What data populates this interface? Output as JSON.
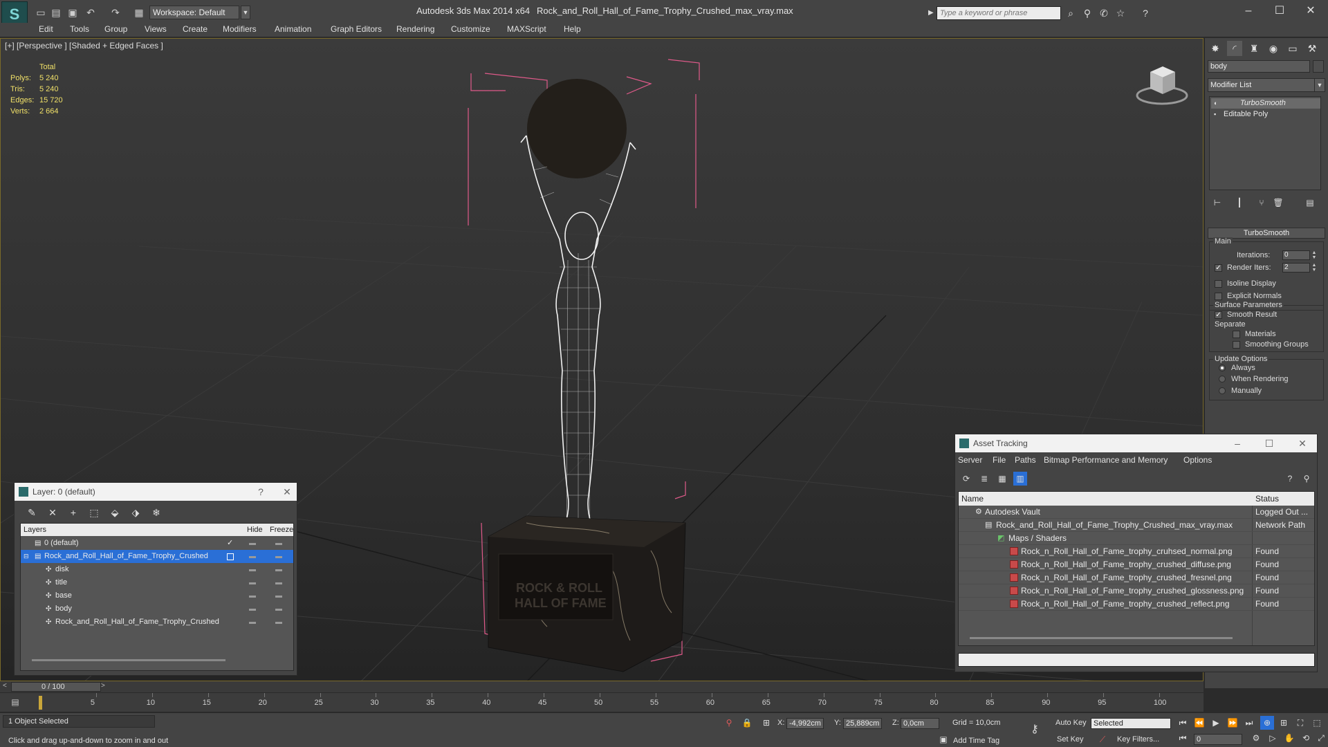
{
  "titlebar": {
    "workspace": "Workspace: Default",
    "app_title": "Autodesk 3ds Max  2014 x64",
    "file_title": "Rock_and_Roll_Hall_of_Fame_Trophy_Crushed_max_vray.max",
    "search_placeholder": "Type a keyword or phrase"
  },
  "menu": [
    "Edit",
    "Tools",
    "Group",
    "Views",
    "Create",
    "Modifiers",
    "Animation",
    "Graph Editors",
    "Rendering",
    "Customize",
    "MAXScript",
    "Help"
  ],
  "viewport": {
    "label": "[+] [Perspective ] [Shaded + Edged Faces ]",
    "stats_header": "Total",
    "stats": [
      {
        "key": "Polys:",
        "value": "5 240"
      },
      {
        "key": "Tris:",
        "value": "5 240"
      },
      {
        "key": "Edges:",
        "value": "15 720"
      },
      {
        "key": "Verts:",
        "value": "2 664"
      }
    ],
    "plaque_line1": "ROCK & ROLL",
    "plaque_line2": "HALL OF FAME"
  },
  "command_panel": {
    "object_name": "body",
    "modifier_list": "Modifier List",
    "stack": [
      "TurboSmooth",
      "Editable Poly"
    ],
    "rollout_title": "TurboSmooth",
    "main_group": "Main",
    "iterations_label": "Iterations:",
    "iterations_value": "0",
    "render_iters_label": "Render Iters:",
    "render_iters_value": "2",
    "isoline_label": "Isoline Display",
    "explicit_normals_label": "Explicit Normals",
    "surface_group": "Surface Parameters",
    "smooth_result_label": "Smooth Result",
    "separate_label": "Separate",
    "materials_label": "Materials",
    "smoothing_groups_label": "Smoothing Groups",
    "update_group": "Update Options",
    "always_label": "Always",
    "when_rendering_label": "When Rendering",
    "manually_label": "Manually"
  },
  "layer_window": {
    "title": "Layer: 0 (default)",
    "help": "?",
    "close": "✕",
    "col_layers": "Layers",
    "col_hide": "Hide",
    "col_freeze": "Freeze",
    "rows": [
      {
        "name": "0 (default)",
        "level": 1
      },
      {
        "name": "Rock_and_Roll_Hall_of_Fame_Trophy_Crushed",
        "level": 1
      },
      {
        "name": "disk",
        "level": 2
      },
      {
        "name": "title",
        "level": 2
      },
      {
        "name": "base",
        "level": 2
      },
      {
        "name": "body",
        "level": 2
      },
      {
        "name": "Rock_and_Roll_Hall_of_Fame_Trophy_Crushed",
        "level": 2
      }
    ]
  },
  "asset_window": {
    "title": "Asset Tracking",
    "menu": [
      "Server",
      "File",
      "Paths",
      "Bitmap Performance and Memory",
      "Options"
    ],
    "col_name": "Name",
    "col_status": "Status",
    "rows": [
      {
        "name": "Autodesk Vault",
        "status": "Logged Out ...",
        "level": 1
      },
      {
        "name": "Rock_and_Roll_Hall_of_Fame_Trophy_Crushed_max_vray.max",
        "status": "Network Path",
        "level": 2
      },
      {
        "name": "Maps / Shaders",
        "status": "",
        "level": 3
      },
      {
        "name": "Rock_n_Roll_Hall_of_Fame_trophy_cruhsed_normal.png",
        "status": "Found",
        "level": 4
      },
      {
        "name": "Rock_n_Roll_Hall_of_Fame_trophy_crushed_diffuse.png",
        "status": "Found",
        "level": 4
      },
      {
        "name": "Rock_n_Roll_Hall_of_Fame_trophy_crushed_fresnel.png",
        "status": "Found",
        "level": 4
      },
      {
        "name": "Rock_n_Roll_Hall_of_Fame_trophy_crushed_glossness.png",
        "status": "Found",
        "level": 4
      },
      {
        "name": "Rock_n_Roll_Hall_of_Fame_trophy_crushed_reflect.png",
        "status": "Found",
        "level": 4
      }
    ]
  },
  "timeline": {
    "frame_label": "0 / 100",
    "ticks": [
      "5",
      "10",
      "15",
      "20",
      "25",
      "30",
      "35",
      "40",
      "45",
      "50",
      "55",
      "60",
      "65",
      "70",
      "75",
      "80",
      "85",
      "90",
      "95",
      "100"
    ]
  },
  "statusbar": {
    "selection": "1 Object Selected",
    "prompt": "Click and drag up-and-down to zoom in and out",
    "x_label": "X:",
    "x_value": "-4,992cm",
    "y_label": "Y:",
    "y_value": "25,889cm",
    "z_label": "Z:",
    "z_value": "0,0cm",
    "grid": "Grid = 10,0cm",
    "add_time_tag": "Add Time Tag",
    "auto_key": "Auto Key",
    "set_key": "Set Key",
    "selected_dropdown": "Selected",
    "key_filters": "Key Filters...",
    "frame_field": "0"
  },
  "colors": {
    "stats_yellow": "#f0e068",
    "selection_blue": "#2a6fd6",
    "bbox_pink": "#e05a8a"
  }
}
